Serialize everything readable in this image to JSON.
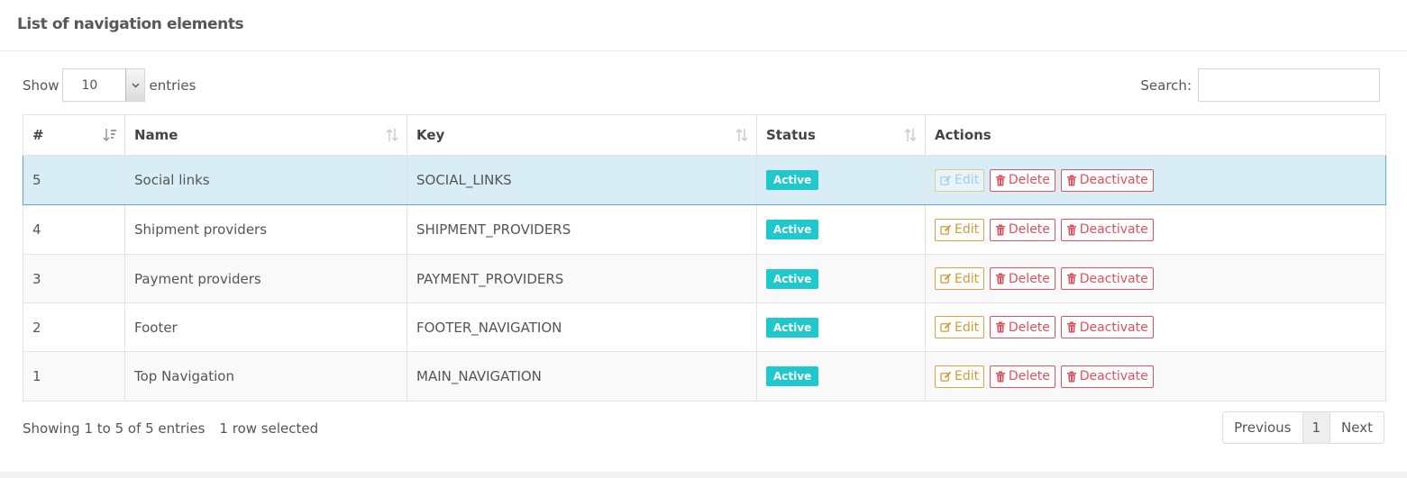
{
  "header": {
    "title": "List of navigation elements"
  },
  "length": {
    "show_label": "Show",
    "selected": "10",
    "entries_label": "entries"
  },
  "search": {
    "label": "Search:",
    "value": "",
    "placeholder": ""
  },
  "table": {
    "columns": [
      {
        "label": "#",
        "sort": "descending"
      },
      {
        "label": "Name",
        "sort": "none"
      },
      {
        "label": "Key",
        "sort": "none"
      },
      {
        "label": "Status",
        "sort": "none"
      },
      {
        "label": "Actions",
        "sort": "disabled"
      }
    ],
    "rows": [
      {
        "id": "5",
        "name": "Social links",
        "key": "SOCIAL_LINKS",
        "status": "Active",
        "selected": true
      },
      {
        "id": "4",
        "name": "Shipment providers",
        "key": "SHIPMENT_PROVIDERS",
        "status": "Active",
        "selected": false
      },
      {
        "id": "3",
        "name": "Payment providers",
        "key": "PAYMENT_PROVIDERS",
        "status": "Active",
        "selected": false
      },
      {
        "id": "2",
        "name": "Footer",
        "key": "FOOTER_NAVIGATION",
        "status": "Active",
        "selected": false
      },
      {
        "id": "1",
        "name": "Top Navigation",
        "key": "MAIN_NAVIGATION",
        "status": "Active",
        "selected": false
      }
    ],
    "actions": {
      "edit": "Edit",
      "delete": "Delete",
      "deactivate": "Deactivate"
    }
  },
  "footer": {
    "info": "Showing 1 to 5 of 5 entries",
    "selection": "1 row selected",
    "pagination": {
      "previous": "Previous",
      "current": "1",
      "next": "Next"
    }
  },
  "colors": {
    "badge": "#1fc8cd",
    "edit": "#d39b34",
    "danger": "#e0505e",
    "selected_row": "#d9edf7",
    "selected_border": "#5fa8d0"
  },
  "icons": {
    "edit": "pencil-square-icon",
    "delete": "trash-icon",
    "deactivate": "trash-icon",
    "sort": "sort-arrows-icon"
  }
}
